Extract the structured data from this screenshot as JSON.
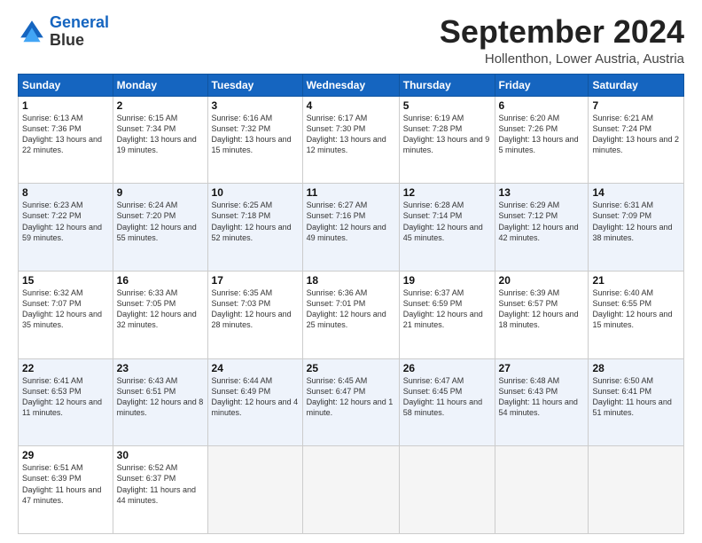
{
  "logo": {
    "line1": "General",
    "line2": "Blue"
  },
  "title": "September 2024",
  "location": "Hollenthon, Lower Austria, Austria",
  "days_of_week": [
    "Sunday",
    "Monday",
    "Tuesday",
    "Wednesday",
    "Thursday",
    "Friday",
    "Saturday"
  ],
  "weeks": [
    [
      {
        "day": 1,
        "sunrise": "6:13 AM",
        "sunset": "7:36 PM",
        "daylight": "13 hours and 22 minutes."
      },
      {
        "day": 2,
        "sunrise": "6:15 AM",
        "sunset": "7:34 PM",
        "daylight": "13 hours and 19 minutes."
      },
      {
        "day": 3,
        "sunrise": "6:16 AM",
        "sunset": "7:32 PM",
        "daylight": "13 hours and 15 minutes."
      },
      {
        "day": 4,
        "sunrise": "6:17 AM",
        "sunset": "7:30 PM",
        "daylight": "13 hours and 12 minutes."
      },
      {
        "day": 5,
        "sunrise": "6:19 AM",
        "sunset": "7:28 PM",
        "daylight": "13 hours and 9 minutes."
      },
      {
        "day": 6,
        "sunrise": "6:20 AM",
        "sunset": "7:26 PM",
        "daylight": "13 hours and 5 minutes."
      },
      {
        "day": 7,
        "sunrise": "6:21 AM",
        "sunset": "7:24 PM",
        "daylight": "13 hours and 2 minutes."
      }
    ],
    [
      {
        "day": 8,
        "sunrise": "6:23 AM",
        "sunset": "7:22 PM",
        "daylight": "12 hours and 59 minutes."
      },
      {
        "day": 9,
        "sunrise": "6:24 AM",
        "sunset": "7:20 PM",
        "daylight": "12 hours and 55 minutes."
      },
      {
        "day": 10,
        "sunrise": "6:25 AM",
        "sunset": "7:18 PM",
        "daylight": "12 hours and 52 minutes."
      },
      {
        "day": 11,
        "sunrise": "6:27 AM",
        "sunset": "7:16 PM",
        "daylight": "12 hours and 49 minutes."
      },
      {
        "day": 12,
        "sunrise": "6:28 AM",
        "sunset": "7:14 PM",
        "daylight": "12 hours and 45 minutes."
      },
      {
        "day": 13,
        "sunrise": "6:29 AM",
        "sunset": "7:12 PM",
        "daylight": "12 hours and 42 minutes."
      },
      {
        "day": 14,
        "sunrise": "6:31 AM",
        "sunset": "7:09 PM",
        "daylight": "12 hours and 38 minutes."
      }
    ],
    [
      {
        "day": 15,
        "sunrise": "6:32 AM",
        "sunset": "7:07 PM",
        "daylight": "12 hours and 35 minutes."
      },
      {
        "day": 16,
        "sunrise": "6:33 AM",
        "sunset": "7:05 PM",
        "daylight": "12 hours and 32 minutes."
      },
      {
        "day": 17,
        "sunrise": "6:35 AM",
        "sunset": "7:03 PM",
        "daylight": "12 hours and 28 minutes."
      },
      {
        "day": 18,
        "sunrise": "6:36 AM",
        "sunset": "7:01 PM",
        "daylight": "12 hours and 25 minutes."
      },
      {
        "day": 19,
        "sunrise": "6:37 AM",
        "sunset": "6:59 PM",
        "daylight": "12 hours and 21 minutes."
      },
      {
        "day": 20,
        "sunrise": "6:39 AM",
        "sunset": "6:57 PM",
        "daylight": "12 hours and 18 minutes."
      },
      {
        "day": 21,
        "sunrise": "6:40 AM",
        "sunset": "6:55 PM",
        "daylight": "12 hours and 15 minutes."
      }
    ],
    [
      {
        "day": 22,
        "sunrise": "6:41 AM",
        "sunset": "6:53 PM",
        "daylight": "12 hours and 11 minutes."
      },
      {
        "day": 23,
        "sunrise": "6:43 AM",
        "sunset": "6:51 PM",
        "daylight": "12 hours and 8 minutes."
      },
      {
        "day": 24,
        "sunrise": "6:44 AM",
        "sunset": "6:49 PM",
        "daylight": "12 hours and 4 minutes."
      },
      {
        "day": 25,
        "sunrise": "6:45 AM",
        "sunset": "6:47 PM",
        "daylight": "12 hours and 1 minute."
      },
      {
        "day": 26,
        "sunrise": "6:47 AM",
        "sunset": "6:45 PM",
        "daylight": "11 hours and 58 minutes."
      },
      {
        "day": 27,
        "sunrise": "6:48 AM",
        "sunset": "6:43 PM",
        "daylight": "11 hours and 54 minutes."
      },
      {
        "day": 28,
        "sunrise": "6:50 AM",
        "sunset": "6:41 PM",
        "daylight": "11 hours and 51 minutes."
      }
    ],
    [
      {
        "day": 29,
        "sunrise": "6:51 AM",
        "sunset": "6:39 PM",
        "daylight": "11 hours and 47 minutes."
      },
      {
        "day": 30,
        "sunrise": "6:52 AM",
        "sunset": "6:37 PM",
        "daylight": "11 hours and 44 minutes."
      },
      null,
      null,
      null,
      null,
      null
    ]
  ]
}
